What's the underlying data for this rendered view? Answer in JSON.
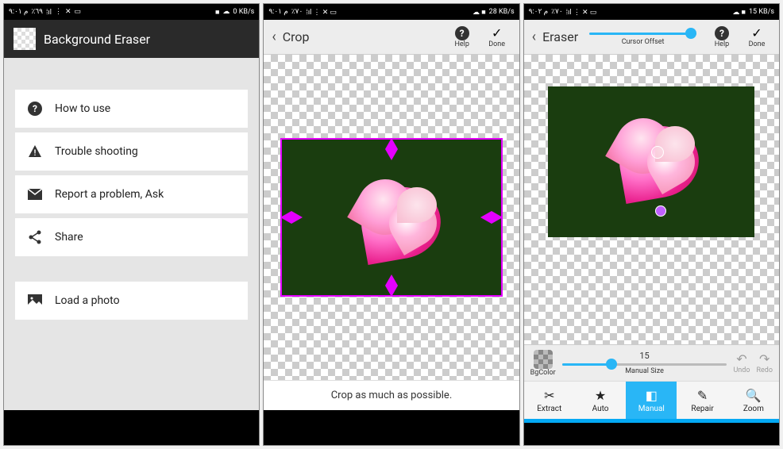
{
  "status": {
    "time1": "م ٩:٠١",
    "time2": "م ٩:٠١",
    "time3": "م ٩:٠٢",
    "battery1": "٪٦٩",
    "battery2": "٪٧٠",
    "battery3": "٪٧٠",
    "net1": "0",
    "net2": "28",
    "net3": "15",
    "net_unit": "KB/s"
  },
  "screen1": {
    "title": "Background Eraser",
    "menu": {
      "how": "How to use",
      "trouble": "Trouble shooting",
      "report": "Report a problem, Ask",
      "share": "Share",
      "load": "Load a photo"
    }
  },
  "screen2": {
    "title": "Crop",
    "help": "Help",
    "done": "Done",
    "hint": "Crop as much as possible."
  },
  "screen3": {
    "title": "Eraser",
    "offset_label": "Cursor Offset",
    "help": "Help",
    "done": "Done",
    "bgcolor": "BgColor",
    "size_value": "15",
    "size_label": "Manual Size",
    "undo": "Undo",
    "redo": "Redo",
    "modes": {
      "extract": "Extract",
      "auto": "Auto",
      "manual": "Manual",
      "repair": "Repair",
      "zoom": "Zoom"
    }
  }
}
